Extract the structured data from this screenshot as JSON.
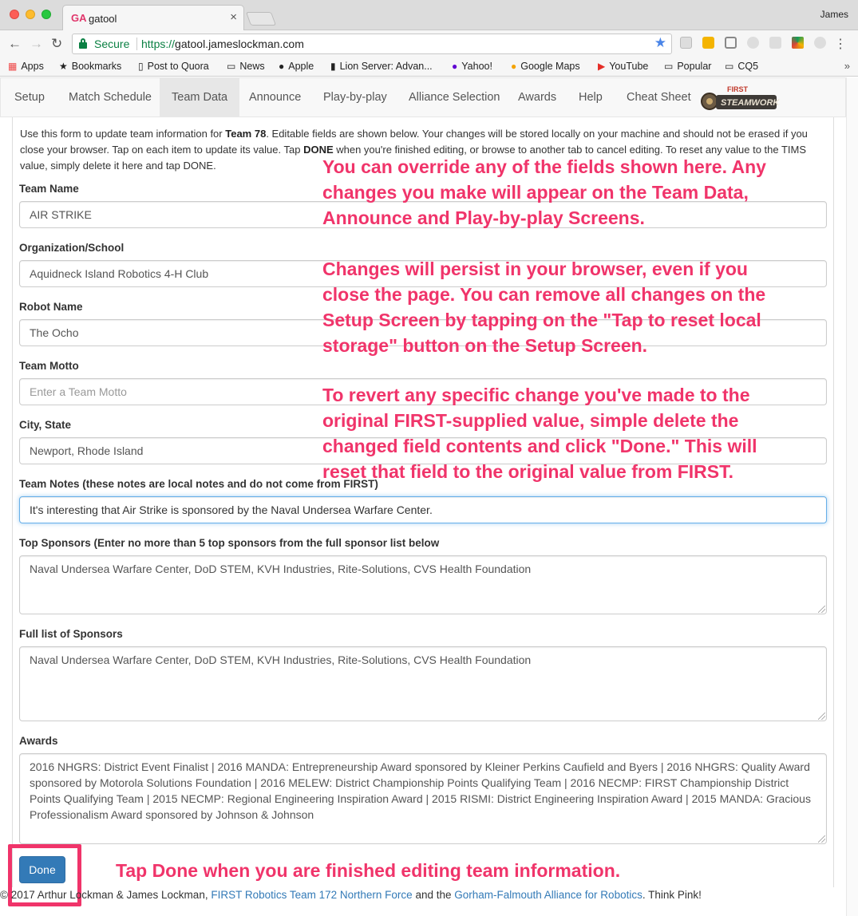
{
  "browser": {
    "tab_title": "gatool",
    "tab_favicon": "GA",
    "profile_name": "James",
    "secure_label": "Secure",
    "url_scheme": "https://",
    "url_host": "gatool.jameslockman.com",
    "bookmarks": [
      {
        "label": "Apps",
        "icon": "apps-grid-icon"
      },
      {
        "label": "Bookmarks",
        "icon": "star-icon"
      },
      {
        "label": "Post to Quora",
        "icon": "page-icon"
      },
      {
        "label": "News",
        "icon": "folder-icon"
      },
      {
        "label": "Apple",
        "icon": "apple-icon"
      },
      {
        "label": "Lion Server: Advan...",
        "icon": "server-icon"
      },
      {
        "label": "Yahoo!",
        "icon": "yahoo-icon"
      },
      {
        "label": "Google Maps",
        "icon": "maps-icon"
      },
      {
        "label": "YouTube",
        "icon": "youtube-icon"
      },
      {
        "label": "Popular",
        "icon": "folder-icon"
      },
      {
        "label": "CQ5",
        "icon": "folder-icon"
      }
    ],
    "bookmarks_overflow": "»"
  },
  "nav": {
    "items": [
      "Setup",
      "Match Schedule",
      "Team Data",
      "Announce",
      "Play-by-play",
      "Alliance Selection",
      "Awards",
      "Help",
      "Cheat Sheet"
    ],
    "active": "Team Data",
    "logo_text_top": "FIRST",
    "logo_text": "STEAMWORKS"
  },
  "intro": {
    "part1": "Use this form to update team information for ",
    "team": "Team 78",
    "part2": ". Editable fields are shown below. Your changes will be stored locally on your machine and should not be erased if you close your browser. Tap on each item to update its value. Tap ",
    "done_word": "DONE",
    "part3": " when you're finished editing, or browse to another tab to cancel editing. To reset any value to the TIMS value, simply delete it here and tap DONE."
  },
  "fields": {
    "team_name": {
      "label": "Team Name",
      "value": "AIR STRIKE"
    },
    "organization": {
      "label": "Organization/School",
      "value": "Aquidneck Island Robotics 4-H Club"
    },
    "robot_name": {
      "label": "Robot Name",
      "value": "The Ocho"
    },
    "team_motto": {
      "label": "Team Motto",
      "placeholder": "Enter a Team Motto"
    },
    "city_state": {
      "label": "City, State",
      "value": "Newport, Rhode Island"
    },
    "team_notes": {
      "label": "Team Notes (these notes are local notes and do not come from FIRST)",
      "value": "It's interesting that Air Strike is sponsored by the Naval Undersea Warfare Center."
    },
    "top_sponsors": {
      "label": "Top Sponsors (Enter no more than 5 top sponsors from the full sponsor list below",
      "value": "Naval Undersea Warfare Center, DoD STEM, KVH Industries, Rite-Solutions, CVS Health Foundation"
    },
    "full_sponsors": {
      "label": "Full list of Sponsors",
      "value": "Naval Undersea Warfare Center, DoD STEM, KVH Industries, Rite-Solutions, CVS Health Foundation"
    },
    "awards": {
      "label": "Awards",
      "value": "2016 NHGRS: District Event Finalist | 2016 MANDA: Entrepreneurship Award sponsored by Kleiner Perkins Caufield and Byers | 2016 NHGRS: Quality Award sponsored by Motorola Solutions Foundation | 2016 MELEW: District Championship Points Qualifying Team | 2016 NECMP: FIRST Championship District Points Qualifying Team | 2015 NECMP: Regional Engineering Inspiration Award | 2015 RISMI: District Engineering Inspiration Award | 2015 MANDA: Gracious Professionalism Award sponsored by Johnson & Johnson"
    }
  },
  "done_button": "Done",
  "footer": {
    "prefix": "© 2017 Arthur Lockman & James Lockman, ",
    "link1": "FIRST Robotics Team 172 Northern Force",
    "middle": " and the ",
    "link2": "Gorham-Falmouth Alliance for Robotics",
    "suffix": ". Think Pink!"
  },
  "annotations": {
    "block1": [
      "You can override any of the fields shown here. Any",
      "changes you make will appear on the Team Data,",
      "Announce and Play-by-play Screens."
    ],
    "block2": [
      "Changes will persist in your browser, even if you",
      "close the page. You can remove all changes on the",
      "Setup Screen by tapping on the \"Tap to reset local",
      "storage\" button on the Setup Screen."
    ],
    "block3": [
      "To revert any specific change you've made to the",
      "original FIRST-supplied value, simple delete the",
      "changed field contents and click \"Done.\" This will",
      "reset that field to the original value from FIRST."
    ],
    "done_note": "Tap Done when you are finished editing team information.",
    "color": "#f0346a"
  }
}
